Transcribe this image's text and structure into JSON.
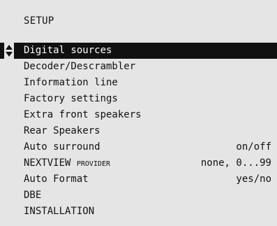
{
  "screen": {
    "title": "SETUP"
  },
  "menu": {
    "items": [
      {
        "label": "Digital sources",
        "value": ""
      },
      {
        "label": "Decoder/Descrambler",
        "value": ""
      },
      {
        "label": "Information line",
        "value": ""
      },
      {
        "label": "Factory settings",
        "value": ""
      },
      {
        "label": "Extra front speakers",
        "value": ""
      },
      {
        "label": "Rear Speakers",
        "value": ""
      },
      {
        "label": "Auto surround",
        "value": "on/off"
      },
      {
        "label": "NEXTVIEW provider",
        "value": "none, 0...99"
      },
      {
        "label": "Auto Format",
        "value": "yes/no"
      },
      {
        "label": "DBE",
        "value": ""
      },
      {
        "label": "INSTALLATION",
        "value": ""
      }
    ],
    "selected_index": 0
  },
  "icons": {
    "cursor": "up-down-arrows-icon"
  },
  "colors": {
    "background": "#e5e5e5",
    "selection": "#111111",
    "text": "#111111",
    "selected_text": "#ffffff"
  }
}
